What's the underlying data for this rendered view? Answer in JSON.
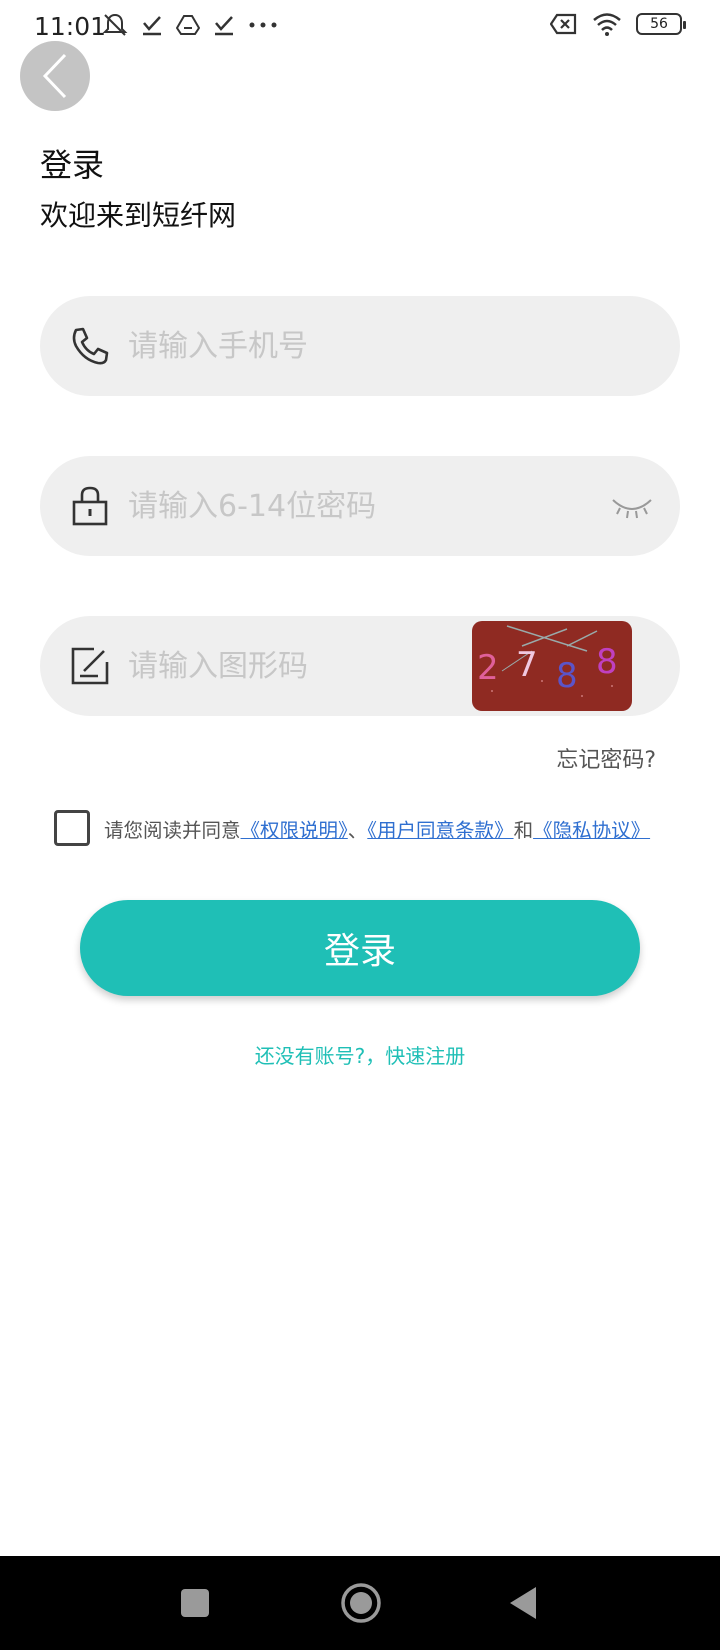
{
  "status_bar": {
    "time": "11:01",
    "battery": "56"
  },
  "header": {
    "title": "登录",
    "subtitle": "欢迎来到短纤网"
  },
  "form": {
    "phone_placeholder": "请输入手机号",
    "password_placeholder": "请输入6-14位密码",
    "captcha_placeholder": "请输入图形码",
    "captcha_digits": [
      "2",
      "7",
      "8",
      "8"
    ],
    "forgot_password": "忘记密码?"
  },
  "agreement": {
    "prefix": "请您阅读并同意",
    "link_permissions": "《权限说明》",
    "separator": "、",
    "link_terms": "《用户同意条款》",
    "conjunction": "和",
    "link_privacy": "《隐私协议》"
  },
  "actions": {
    "login_label": "登录",
    "register_label": "还没有账号?，快速注册"
  },
  "colors": {
    "accent": "#1fbfb6",
    "link": "#2f6fd0",
    "field_bg": "#efefef",
    "captcha_bg": "#8f2a22"
  }
}
